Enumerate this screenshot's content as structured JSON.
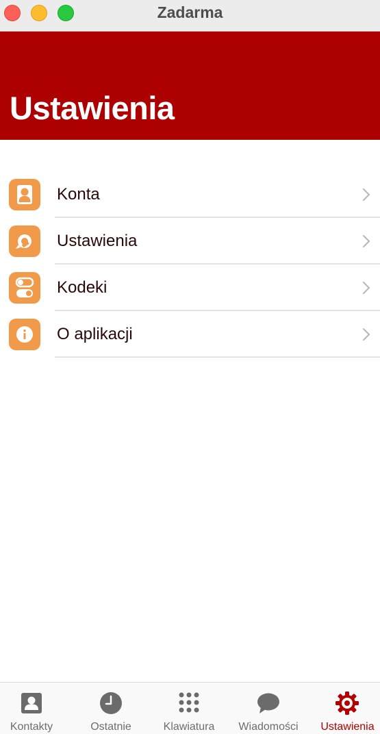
{
  "window": {
    "title": "Zadarma"
  },
  "header": {
    "title": "Ustawienia"
  },
  "colors": {
    "header_bg": "#ad0000",
    "icon_bg": "#f09a4a",
    "active_tab": "#b00000"
  },
  "settings_list": [
    {
      "label": "Konta",
      "icon": "user-icon"
    },
    {
      "label": "Ustawienia",
      "icon": "sync-icon"
    },
    {
      "label": "Kodeki",
      "icon": "toggles-icon"
    },
    {
      "label": "O aplikacji",
      "icon": "info-icon"
    }
  ],
  "tabbar": {
    "tabs": [
      {
        "label": "Kontakty",
        "icon": "contacts-icon",
        "active": false
      },
      {
        "label": "Ostatnie",
        "icon": "clock-icon",
        "active": false
      },
      {
        "label": "Klawiatura",
        "icon": "keypad-icon",
        "active": false
      },
      {
        "label": "Wiadomości",
        "icon": "chat-bubble-icon",
        "active": false
      },
      {
        "label": "Ustawienia",
        "icon": "gear-icon",
        "active": true
      }
    ]
  }
}
